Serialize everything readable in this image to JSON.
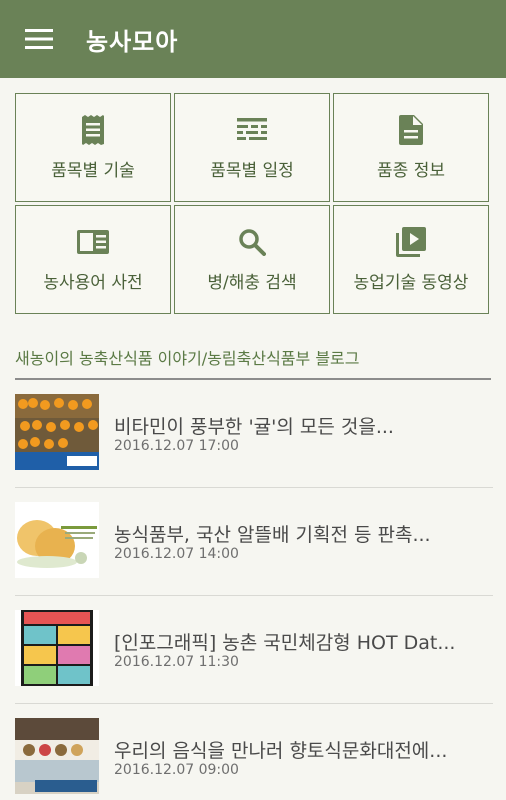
{
  "appbar": {
    "title": "농사모아",
    "menu_icon": "hamburger-menu-icon"
  },
  "menu_tiles": [
    {
      "label": "품목별 기술",
      "icon": "receipt-icon"
    },
    {
      "label": "품목별 일정",
      "icon": "schedule-lines-icon"
    },
    {
      "label": "품종 정보",
      "icon": "document-icon"
    },
    {
      "label": "농사용어 사전",
      "icon": "dictionary-icon"
    },
    {
      "label": "병/해충 검색",
      "icon": "search-icon"
    },
    {
      "label": "농업기술 동영상",
      "icon": "video-library-icon"
    }
  ],
  "blog": {
    "header": "새농이의 농축산식품 이야기/농림축산식품부 블로그",
    "posts": [
      {
        "title": "비타민이 풍부한 '귤'의 모든 것을...",
        "date": "2016.12.07 17:00"
      },
      {
        "title": "농식품부, 국산 알뜰배 기획전 등 판촉...",
        "date": "2016.12.07 14:00"
      },
      {
        "title": "[인포그래픽] 농촌 국민체감형 HOT Dat...",
        "date": "2016.12.07 11:30"
      },
      {
        "title": "우리의 음식을 만나러 향토식문화대전에...",
        "date": "2016.12.07 09:00"
      }
    ]
  },
  "colors": {
    "primary": "#6a8257",
    "tile_border": "#6a8257",
    "label": "#4a6139",
    "background": "#f6f6f1"
  }
}
